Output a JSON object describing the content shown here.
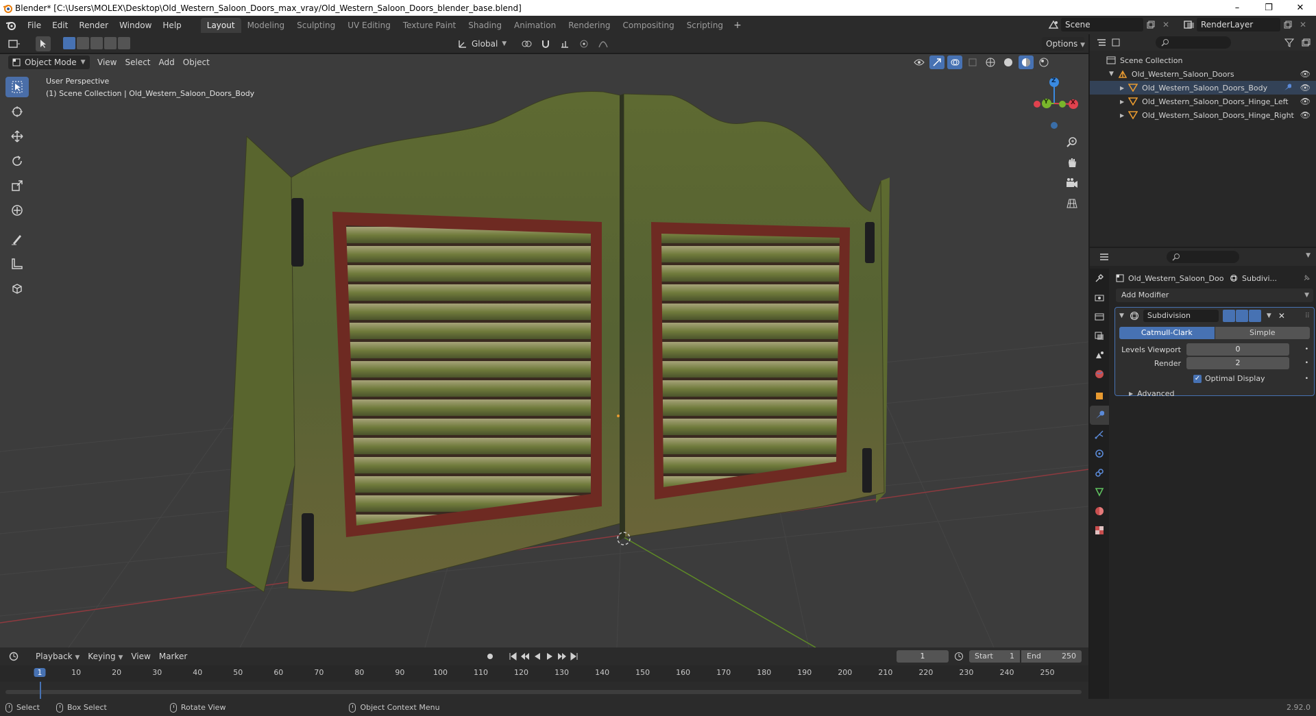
{
  "window": {
    "title": "Blender* [C:\\Users\\MOLEX\\Desktop\\Old_Western_Saloon_Doors_max_vray/Old_Western_Saloon_Doors_blender_base.blend]",
    "minimize": "–",
    "restore": "❐",
    "close": "✕"
  },
  "menu": {
    "items": [
      "File",
      "Edit",
      "Render",
      "Window",
      "Help"
    ]
  },
  "workspaces": {
    "tabs": [
      "Layout",
      "Modeling",
      "Sculpting",
      "UV Editing",
      "Texture Paint",
      "Shading",
      "Animation",
      "Rendering",
      "Compositing",
      "Scripting"
    ],
    "active": "Layout",
    "add": "+"
  },
  "scene": {
    "name": "Scene",
    "view_layer": "RenderLayer"
  },
  "tool_header": {
    "orientation": "Global",
    "options": "Options"
  },
  "viewport_header": {
    "mode": "Object Mode",
    "menus": [
      "View",
      "Select",
      "Add",
      "Object"
    ]
  },
  "viewport": {
    "perspective": "User Perspective",
    "collection_info": "(1) Scene Collection | Old_Western_Saloon_Doors_Body",
    "gizmo": {
      "z": "Z",
      "y": "Y",
      "x": "X"
    }
  },
  "outliner": {
    "root": "Scene Collection",
    "collection": "Old_Western_Saloon_Doors",
    "objects": [
      "Old_Western_Saloon_Doors_Body",
      "Old_Western_Saloon_Doors_Hinge_Left",
      "Old_Western_Saloon_Doors_Hinge_Right"
    ]
  },
  "properties": {
    "object_name": "Old_Western_Saloon_Doo...",
    "modifier_short": "Subdivi...",
    "add_modifier": "Add Modifier",
    "modifier": {
      "name": "Subdivision",
      "types": [
        "Catmull-Clark",
        "Simple"
      ],
      "active_type": "Catmull-Clark",
      "levels_viewport_label": "Levels Viewport",
      "levels_viewport": "0",
      "render_label": "Render",
      "render": "2",
      "optimal_display_label": "Optimal Display",
      "optimal_display": true,
      "advanced": "Advanced"
    }
  },
  "timeline": {
    "menus": [
      "Playback",
      "Keying",
      "View",
      "Marker"
    ],
    "current_frame": "1",
    "start_label": "Start",
    "start": "1",
    "end_label": "End",
    "end": "250",
    "ruler": [
      "1",
      "10",
      "20",
      "30",
      "40",
      "50",
      "60",
      "70",
      "80",
      "90",
      "100",
      "110",
      "120",
      "130",
      "140",
      "150",
      "160",
      "170",
      "180",
      "190",
      "200",
      "210",
      "220",
      "230",
      "240",
      "250"
    ]
  },
  "statusbar": {
    "select": "Select",
    "box_select": "Box Select",
    "rotate_view": "Rotate View",
    "context_menu": "Object Context Menu",
    "version": "2.92.0"
  },
  "colors": {
    "accent": "#4772b3",
    "viewport_bg": "#3c3c3c",
    "x_axis": "#e0424e",
    "y_axis": "#79b52b",
    "z_axis": "#3a8ae0"
  }
}
